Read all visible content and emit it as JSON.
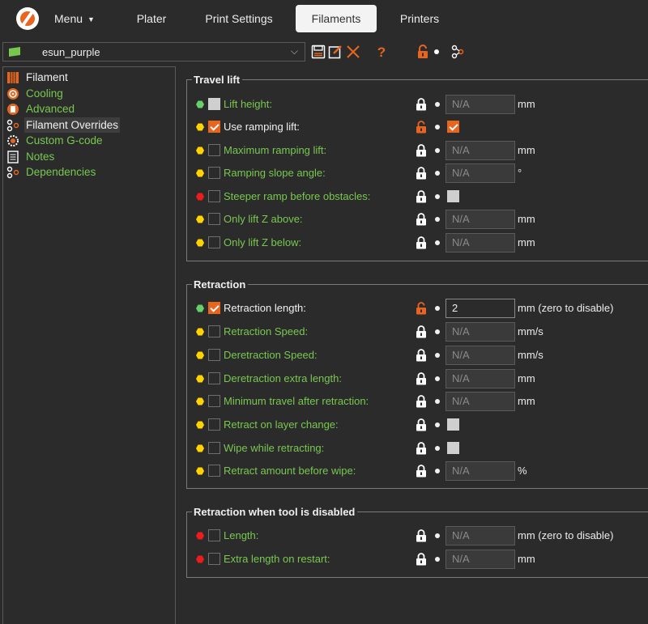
{
  "tabs": {
    "menu": "Menu",
    "plater": "Plater",
    "print_settings": "Print Settings",
    "filaments": "Filaments",
    "printers": "Printers",
    "active": "Filaments"
  },
  "preset": {
    "name": "esun_purple",
    "flag_color": "#78c850"
  },
  "toolbar": {
    "icons": [
      "save-icon",
      "rename-icon",
      "delete-icon",
      "help-icon",
      "unlock-icon",
      "dot-icon",
      "dependencies-icon"
    ],
    "accent_color": "#e8651f"
  },
  "sidebar": {
    "items": [
      {
        "label": "Filament",
        "icon": "filament-icon",
        "color": "white"
      },
      {
        "label": "Cooling",
        "icon": "cooling-icon",
        "color": "green"
      },
      {
        "label": "Advanced",
        "icon": "advanced-icon",
        "color": "green"
      },
      {
        "label": "Filament Overrides",
        "icon": "overrides-icon",
        "color": "white",
        "selected": true
      },
      {
        "label": "Custom G-code",
        "icon": "gcode-icon",
        "color": "green"
      },
      {
        "label": "Notes",
        "icon": "notes-icon",
        "color": "green"
      },
      {
        "label": "Dependencies",
        "icon": "dependencies-icon",
        "color": "green"
      }
    ]
  },
  "groups": {
    "travel_lift": {
      "title": "Travel lift",
      "rows": [
        {
          "label": "Lift height:",
          "status": "green",
          "enabled": false,
          "value": "N/A",
          "unit": "mm"
        },
        {
          "label": "Use ramping lift:",
          "status": "yellow",
          "enabled": true
        },
        {
          "label": "Maximum ramping lift:",
          "status": "yellow",
          "enabled": false,
          "value": "N/A",
          "unit": "mm"
        },
        {
          "label": "Ramping slope angle:",
          "status": "yellow",
          "enabled": false,
          "value": "N/A",
          "unit": "°"
        },
        {
          "label": "Steeper ramp before obstacles:",
          "status": "red",
          "enabled": false
        },
        {
          "label": "Only lift Z above:",
          "status": "yellow",
          "enabled": false,
          "value": "N/A",
          "unit": "mm"
        },
        {
          "label": "Only lift Z below:",
          "status": "yellow",
          "enabled": false,
          "value": "N/A",
          "unit": "mm"
        }
      ]
    },
    "retraction": {
      "title": "Retraction",
      "rows": [
        {
          "label": "Retraction length:",
          "status": "green",
          "enabled": true,
          "value": "2",
          "unit": "mm (zero to disable)"
        },
        {
          "label": "Retraction Speed:",
          "status": "yellow",
          "enabled": false,
          "value": "N/A",
          "unit": "mm/s"
        },
        {
          "label": "Deretraction Speed:",
          "status": "yellow",
          "enabled": false,
          "value": "N/A",
          "unit": "mm/s"
        },
        {
          "label": "Deretraction extra length:",
          "status": "yellow",
          "enabled": false,
          "value": "N/A",
          "unit": "mm"
        },
        {
          "label": "Minimum travel after retraction:",
          "status": "yellow",
          "enabled": false,
          "value": "N/A",
          "unit": "mm"
        },
        {
          "label": "Retract on layer change:",
          "status": "yellow",
          "enabled": false
        },
        {
          "label": "Wipe while retracting:",
          "status": "yellow",
          "enabled": false
        },
        {
          "label": "Retract amount before wipe:",
          "status": "yellow",
          "enabled": false,
          "value": "N/A",
          "unit": "%"
        }
      ]
    },
    "tool_disabled": {
      "title": "Retraction when tool is disabled",
      "rows": [
        {
          "label": "Length:",
          "status": "red",
          "enabled": false,
          "value": "N/A",
          "unit": "mm (zero to disable)"
        },
        {
          "label": "Extra length on restart:",
          "status": "red",
          "enabled": false,
          "value": "N/A",
          "unit": "mm"
        }
      ]
    }
  },
  "colors": {
    "green_label": "#78c850",
    "orange": "#e8651f",
    "status_green": "#66d16a",
    "status_yellow": "#ffd400",
    "status_red": "#ee1c1c"
  }
}
